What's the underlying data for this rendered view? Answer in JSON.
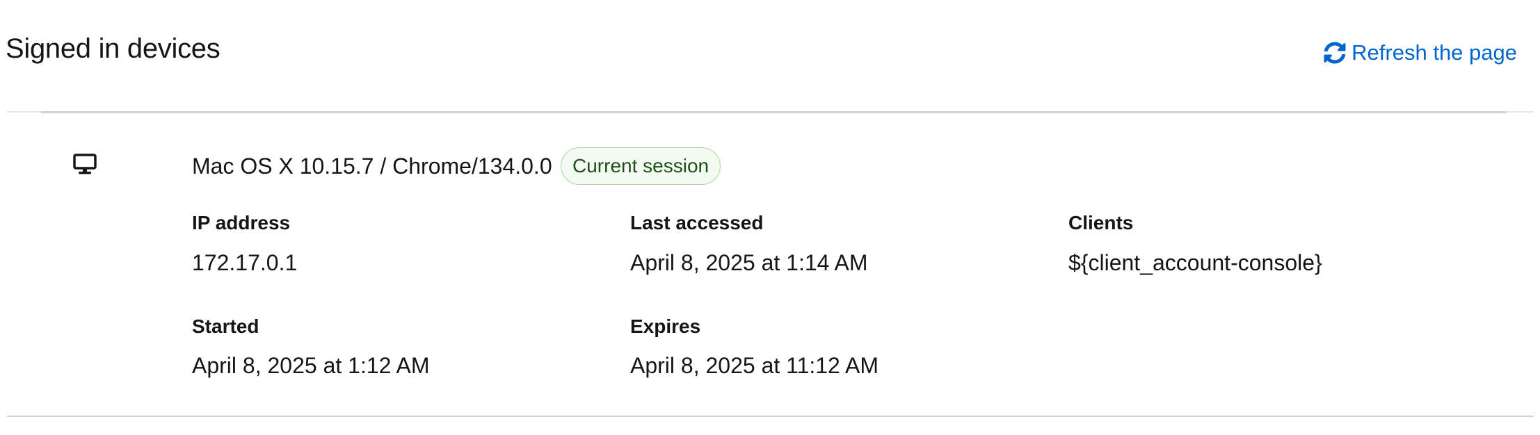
{
  "header": {
    "title": "Signed in devices",
    "refresh_label": "Refresh the page",
    "refresh_icon": "sync-icon"
  },
  "device": {
    "icon": "desktop-icon",
    "name": "Mac OS X 10.15.7 / Chrome/134.0.0",
    "badge": "Current session",
    "fields": {
      "ip_label": "IP address",
      "ip_value": "172.17.0.1",
      "last_accessed_label": "Last accessed",
      "last_accessed_value": "April 8, 2025 at 1:14 AM",
      "clients_label": "Clients",
      "clients_value": "${client_account-console}",
      "started_label": "Started",
      "started_value": "April 8, 2025 at 1:12 AM",
      "expires_label": "Expires",
      "expires_value": "April 8, 2025 at 11:12 AM"
    }
  },
  "colors": {
    "link": "#0066cc",
    "badge_border": "#a9d7a0",
    "badge_bg": "#f3faf2",
    "badge_text": "#1e4f18",
    "text": "#151515",
    "divider": "#d2d2d2"
  }
}
